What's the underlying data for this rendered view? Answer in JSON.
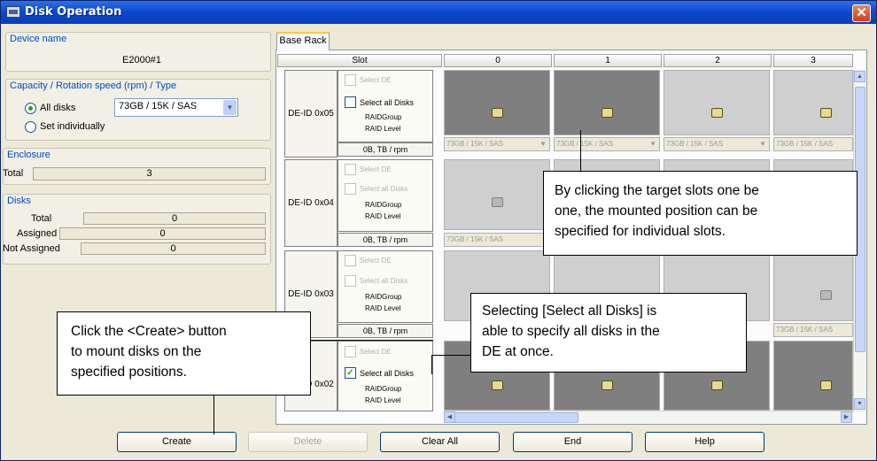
{
  "window": {
    "title": "Disk Operation",
    "close_glyph": "✕",
    "app_icon": "disk-array-icon"
  },
  "device": {
    "group_label": "Device name",
    "value": "E2000#1"
  },
  "capacity": {
    "group_label": "Capacity / Rotation speed (rpm) / Type",
    "option_all": "All disks",
    "option_individual": "Set individually",
    "selected": "73GB / 15K / SAS"
  },
  "enclosure": {
    "group_label": "Enclosure",
    "total_label": "Total",
    "total_value": "3"
  },
  "disks": {
    "group_label": "Disks",
    "total_label": "Total",
    "total_value": "0",
    "assigned_label": "Assigned",
    "assigned_value": "0",
    "not_assigned_label": "Not Assigned",
    "not_assigned_value": "0"
  },
  "tab": {
    "label": "Base Rack"
  },
  "grid": {
    "slot_header": "Slot",
    "columns": [
      "0",
      "1",
      "2",
      "3"
    ],
    "select_de": "Select DE",
    "select_all": "Select all Disks",
    "raid_group": "RAIDGroup",
    "raid_level": "RAID Level",
    "rpm_label": "0B, TB / rpm",
    "slot_value": "73GB / 15K / SAS",
    "rows": [
      {
        "label": "DE-ID 0x05"
      },
      {
        "label": "DE-ID 0x04"
      },
      {
        "label": "DE-ID 0x03"
      },
      {
        "label": "DE-ID 0x02"
      }
    ]
  },
  "buttons": {
    "create": "Create",
    "delete": "Delete",
    "clear_all": "Clear All",
    "end": "End",
    "help": "Help"
  },
  "callouts": {
    "slots_1": "By clicking the target slots one be",
    "slots_2": "one, the mounted position can be",
    "slots_3": "specified for individual slots.",
    "select_1": "Selecting [Select all Disks] is",
    "select_2": "able to specify all disks in the",
    "select_3": "DE at once.",
    "create_1": "Click the <Create> button",
    "create_2": "to mount disks on the",
    "create_3": "specified positions."
  }
}
